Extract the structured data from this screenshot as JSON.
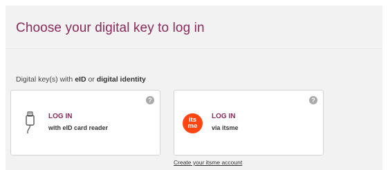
{
  "header": {
    "title": "Choose your digital key to log in"
  },
  "section": {
    "label_prefix": "Digital key(s) with ",
    "label_bold_1": "eID",
    "label_mid": " or ",
    "label_bold_2": "digital identity"
  },
  "cards": [
    {
      "cta": "LOG IN",
      "sub": "with eID card reader",
      "icon": "card-reader-icon",
      "help": "?"
    },
    {
      "cta": "LOG IN",
      "sub": "via itsme",
      "icon": "itsme-logo",
      "logo_text_1": "its",
      "logo_text_2": "me",
      "help": "?"
    }
  ],
  "links": {
    "create_account": "Create your itsme account"
  },
  "colors": {
    "accent": "#8a2a5b",
    "itsme": "#ff4612",
    "panel": "#f2f2f2"
  }
}
